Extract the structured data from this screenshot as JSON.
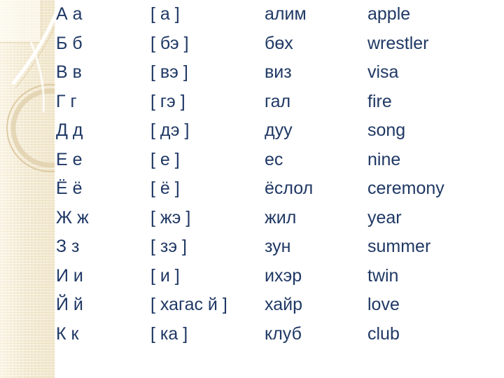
{
  "slide": {
    "background_color": "#ffffff",
    "text_color": "#1f3864",
    "sidebar_color": "#f3ead2"
  },
  "table": {
    "columns": [
      "letters",
      "pronunciation",
      "mongolian_word",
      "english_meaning"
    ],
    "rows": [
      {
        "letters": "А а",
        "pronunciation": "[ а ]",
        "mongolian_word": "алим",
        "english_meaning": "apple"
      },
      {
        "letters": "Б б",
        "pronunciation": "[  бэ ]",
        "mongolian_word": "бөх",
        "english_meaning": "wrestler"
      },
      {
        "letters": "В в",
        "pronunciation": "[ вэ ]",
        "mongolian_word": "виз",
        "english_meaning": "visa"
      },
      {
        "letters": "Г г",
        "pronunciation": "[ гэ ]",
        "mongolian_word": "гал",
        "english_meaning": "fire"
      },
      {
        "letters": "Д д",
        "pronunciation": "[ дэ ]",
        "mongolian_word": "дуу",
        "english_meaning": "song"
      },
      {
        "letters": "Е е",
        "pronunciation": "[ е ]",
        "mongolian_word": "ес",
        "english_meaning": "nine"
      },
      {
        "letters": "Ё ё",
        "pronunciation": "[ ё ]",
        "mongolian_word": "ёслол",
        "english_meaning": "ceremony"
      },
      {
        "letters": "Ж ж",
        "pronunciation": "[ жэ ]",
        "mongolian_word": "жил",
        "english_meaning": "year"
      },
      {
        "letters": "З з",
        "pronunciation": "[ зэ ]",
        "mongolian_word": "зун",
        "english_meaning": "summer"
      },
      {
        "letters": "И и",
        "pronunciation": "[ и ]",
        "mongolian_word": "ихэр",
        "english_meaning": "twin"
      },
      {
        "letters": "Й й",
        "pronunciation": "[ хагас й ]",
        "mongolian_word": "хайр",
        "english_meaning": "love"
      },
      {
        "letters": "К к",
        "pronunciation": "[ ка ]",
        "mongolian_word": "клуб",
        "english_meaning": "club"
      }
    ]
  }
}
